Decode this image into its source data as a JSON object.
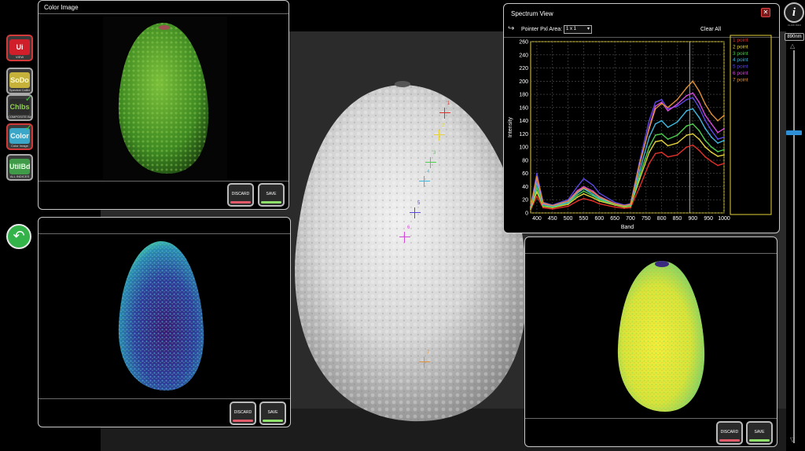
{
  "toolbar": {
    "items": [
      {
        "glyph": "Ui",
        "caption": "VIEW",
        "glyph_bg": "#d01f2a",
        "glyph_color": "#ffffff",
        "checked": false,
        "active": true
      },
      {
        "glyph": "SoDo",
        "caption": "Spectral Calibr",
        "glyph_bg": "#c6b23a",
        "glyph_color": "#fffacc",
        "checked": false,
        "active": false
      },
      {
        "glyph": "Chlbs",
        "caption": "COMPOSITE BANDS",
        "glyph_bg": "#2b2b2b",
        "glyph_color": "#8fd04c",
        "checked": true,
        "active": false
      },
      {
        "glyph": "Color",
        "caption": "Color Image",
        "glyph_bg": "#3aa7c8",
        "glyph_color": "#e8fbff",
        "checked": true,
        "active": true
      },
      {
        "glyph": "UtilBd",
        "caption": "ALL INDICES",
        "glyph_bg": "#3f9b47",
        "glyph_color": "#e8ffe8",
        "checked": false,
        "active": false
      }
    ],
    "undo_icon": "undo-arrow-icon"
  },
  "color_panel": {
    "title": "Color Image",
    "discard_label": "DISCARD",
    "save_label": "SAVE"
  },
  "index_panel": {
    "discard_label": "DISCARD",
    "save_label": "SAVE"
  },
  "right_panel": {
    "discard_label": "DISCARD",
    "save_label": "SAVE"
  },
  "spectrum": {
    "title": "Spectrum View",
    "pointer_label": "Pointer Pxl Area:",
    "pointer_value": "1 x 1",
    "clear_label": "Clear All",
    "close_icon": "close-icon",
    "export_icon": "export-icon"
  },
  "markers": [
    "1",
    "2",
    "3",
    "4",
    "5",
    "6",
    "7"
  ],
  "slider": {
    "readout": "890nm",
    "level": 0.21
  },
  "info": {
    "caption": "CLICK INFO"
  },
  "chart_data": {
    "type": "line",
    "title": "",
    "xlabel": "Band",
    "ylabel": "Intensity",
    "xlim": [
      380,
      1000
    ],
    "ylim": [
      0,
      260
    ],
    "xticks": [
      400,
      450,
      500,
      550,
      600,
      650,
      700,
      750,
      800,
      850,
      900,
      950,
      1000
    ],
    "yticks": [
      0,
      20,
      40,
      60,
      80,
      100,
      120,
      140,
      160,
      180,
      200,
      220,
      240,
      260
    ],
    "grid": true,
    "legend_position": "right",
    "x": [
      380,
      400,
      420,
      450,
      500,
      530,
      550,
      580,
      600,
      650,
      680,
      700,
      730,
      760,
      780,
      800,
      820,
      850,
      880,
      900,
      920,
      940,
      960,
      980,
      1000
    ],
    "series": [
      {
        "name": "1 point",
        "color": "#e0302a",
        "values": [
          5,
          25,
          8,
          6,
          10,
          18,
          22,
          18,
          14,
          9,
          7,
          8,
          40,
          75,
          90,
          92,
          85,
          88,
          100,
          103,
          95,
          85,
          78,
          72,
          75
        ]
      },
      {
        "name": "2 point",
        "color": "#e3d23a",
        "values": [
          6,
          32,
          10,
          8,
          13,
          24,
          29,
          23,
          18,
          12,
          9,
          10,
          52,
          92,
          108,
          110,
          102,
          106,
          118,
          120,
          112,
          100,
          92,
          86,
          88
        ]
      },
      {
        "name": "3 point",
        "color": "#4cd04c",
        "values": [
          7,
          38,
          11,
          9,
          15,
          27,
          33,
          26,
          20,
          13,
          10,
          11,
          58,
          100,
          118,
          120,
          112,
          118,
          132,
          135,
          125,
          110,
          100,
          93,
          96
        ]
      },
      {
        "name": "4 point",
        "color": "#3fb8e0",
        "values": [
          8,
          45,
          13,
          10,
          16,
          30,
          37,
          28,
          22,
          14,
          11,
          12,
          65,
          115,
          135,
          140,
          130,
          138,
          155,
          158,
          145,
          128,
          115,
          106,
          110
        ]
      },
      {
        "name": "5 point",
        "color": "#5a46e0",
        "values": [
          10,
          60,
          16,
          12,
          20,
          40,
          52,
          42,
          30,
          16,
          12,
          14,
          80,
          140,
          168,
          172,
          158,
          162,
          172,
          175,
          160,
          140,
          125,
          112,
          115
        ]
      },
      {
        "name": "6 point",
        "color": "#d24ad8",
        "values": [
          9,
          52,
          14,
          11,
          18,
          34,
          40,
          33,
          25,
          14,
          11,
          13,
          74,
          130,
          162,
          168,
          155,
          165,
          178,
          182,
          168,
          148,
          135,
          122,
          128
        ]
      },
      {
        "name": "7 point",
        "color": "#e09038",
        "values": [
          9,
          55,
          15,
          11,
          18,
          32,
          38,
          31,
          24,
          14,
          11,
          13,
          76,
          128,
          158,
          166,
          160,
          172,
          190,
          200,
          185,
          165,
          150,
          140,
          148
        ]
      }
    ]
  }
}
